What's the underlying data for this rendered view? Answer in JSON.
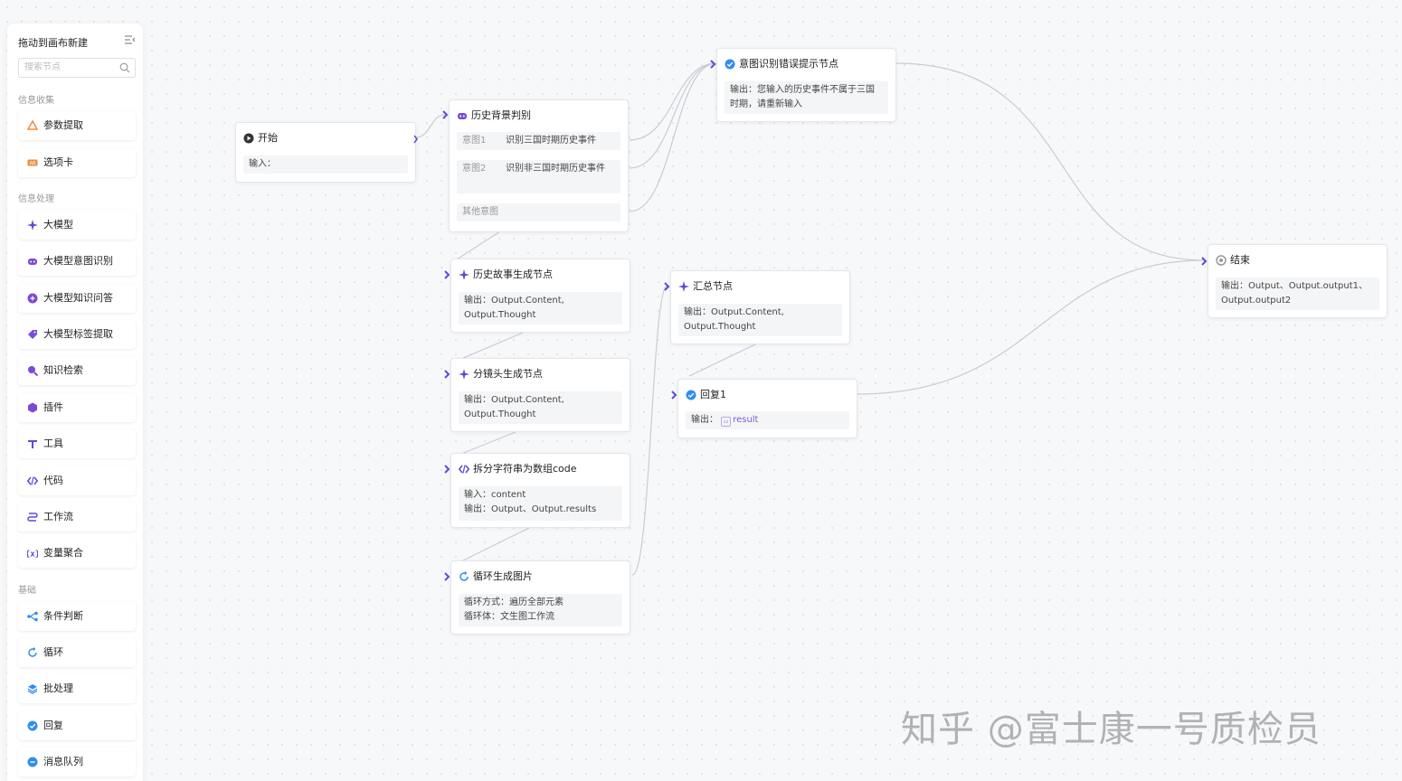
{
  "sidebar": {
    "title": "拖动到画布新建",
    "search_placeholder": "搜索节点",
    "sections": {
      "collect": "信息收集",
      "process": "信息处理",
      "basic": "基础"
    },
    "items": [
      {
        "label": "参数提取",
        "icon": "param-extract-icon",
        "color": "#f08c3a"
      },
      {
        "label": "选项卡",
        "icon": "option-card-icon",
        "color": "#f08c3a"
      },
      {
        "label": "大模型",
        "icon": "sparkle-icon",
        "color": "#5b4bd6"
      },
      {
        "label": "大模型意图识别",
        "icon": "robot-icon",
        "color": "#7a4bd6"
      },
      {
        "label": "大模型知识问答",
        "icon": "qa-icon",
        "color": "#7a4bd6"
      },
      {
        "label": "大模型标签提取",
        "icon": "tag-icon",
        "color": "#7a4bd6"
      },
      {
        "label": "知识检索",
        "icon": "search-knowledge-icon",
        "color": "#7a4bd6"
      },
      {
        "label": "插件",
        "icon": "plugin-icon",
        "color": "#7a4bd6"
      },
      {
        "label": "工具",
        "icon": "tool-icon",
        "color": "#5b4bd6"
      },
      {
        "label": "代码",
        "icon": "code-icon",
        "color": "#5b4bd6"
      },
      {
        "label": "工作流",
        "icon": "workflow-icon",
        "color": "#5b4bd6"
      },
      {
        "label": "变量聚合",
        "icon": "variable-icon",
        "color": "#5b4bd6"
      },
      {
        "label": "条件判断",
        "icon": "branch-icon",
        "color": "#2f8ef0"
      },
      {
        "label": "循环",
        "icon": "loop-icon",
        "color": "#2f8ef0"
      },
      {
        "label": "批处理",
        "icon": "layers-icon",
        "color": "#2f8ef0"
      },
      {
        "label": "回复",
        "icon": "reply-icon",
        "color": "#2f8ef0"
      },
      {
        "label": "消息队列",
        "icon": "message-queue-icon",
        "color": "#2f8ef0"
      }
    ]
  },
  "nodes": {
    "start": {
      "title": "开始",
      "input_label": "输入："
    },
    "history": {
      "title": "历史背景判别",
      "intents": [
        {
          "key": "意图1",
          "value": "识别三国时期历史事件"
        },
        {
          "key": "意图2",
          "value": "识别非三国时期历史事件"
        }
      ],
      "other": "其他意图"
    },
    "error_tip": {
      "title": "意图识别错误提示节点",
      "output": "输出：您输入的历史事件不属于三国时期，请重新输入"
    },
    "story": {
      "title": "历史故事生成节点",
      "output": "输出：Output.Content, Output.Thought"
    },
    "storyboard": {
      "title": "分镜头生成节点",
      "output": "输出：Output.Content, Output.Thought"
    },
    "split": {
      "title": "拆分字符串为数组code",
      "input": "输入：content",
      "output": "输出：Output、Output.results"
    },
    "loop": {
      "title": "循环生成图片",
      "mode": "循环方式：遍历全部元素",
      "body": "循环体：文生图工作流"
    },
    "summary": {
      "title": "汇总节点",
      "output": "输出：Output.Content, Output.Thought"
    },
    "reply": {
      "title": "回复1",
      "output_label": "输出：",
      "var": "result"
    },
    "end": {
      "title": "结束",
      "output": "输出：Output、Output.output1、Output.output2"
    }
  },
  "watermark": "知乎 @富士康一号质检员",
  "colors": {
    "accent": "#5b4bd6",
    "wire": "#c8cbd2",
    "canvas": "#f7f8fa"
  }
}
